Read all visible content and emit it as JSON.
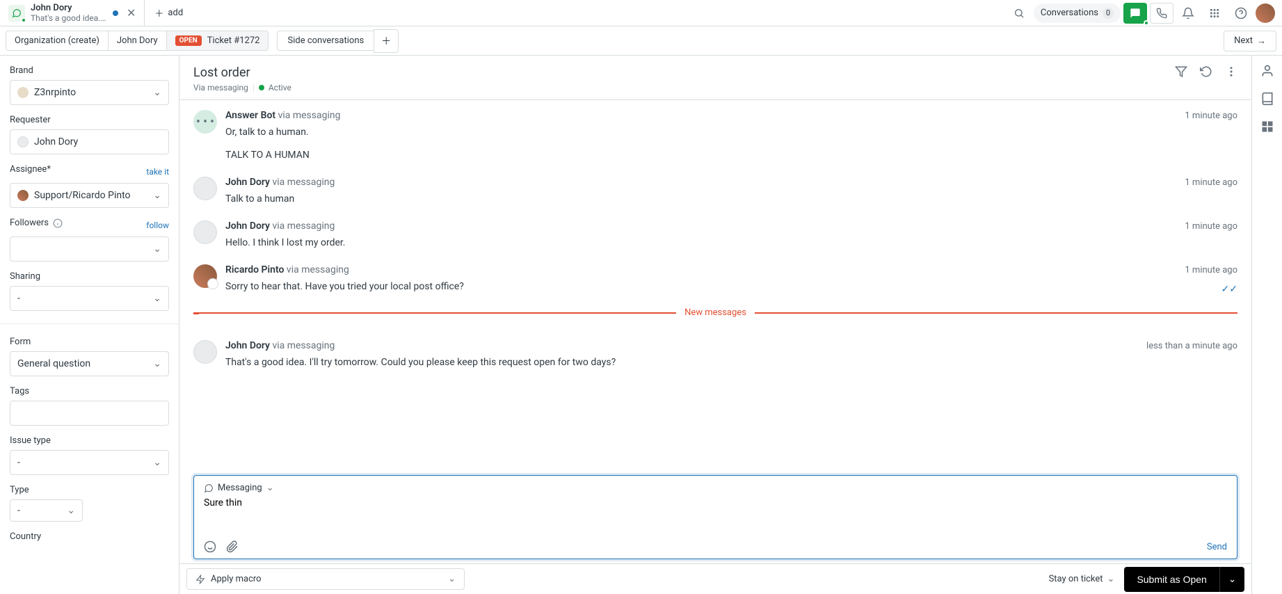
{
  "top": {
    "tab": {
      "title": "John Dory",
      "subtitle": "That's a good idea. I…"
    },
    "add_label": "add",
    "conversations_label": "Conversations",
    "conversations_count": "0"
  },
  "crumbs": {
    "org": "Organization (create)",
    "user": "John Dory",
    "badge": "OPEN",
    "ticket": "Ticket #1272",
    "side_conv": "Side conversations",
    "next": "Next"
  },
  "sidebar": {
    "brand_label": "Brand",
    "brand_value": "Z3nrpinto",
    "requester_label": "Requester",
    "requester_value": "John Dory",
    "assignee_label": "Assignee*",
    "take_it": "take it",
    "assignee_value": "Support/Ricardo Pinto",
    "followers_label": "Followers",
    "follow": "follow",
    "sharing_label": "Sharing",
    "sharing_value": "-",
    "form_label": "Form",
    "form_value": "General question",
    "tags_label": "Tags",
    "issue_label": "Issue type",
    "issue_value": "-",
    "type_label": "Type",
    "type_value": "-",
    "country_label": "Country"
  },
  "header": {
    "title": "Lost order",
    "via": "Via messaging",
    "active": "Active"
  },
  "messages": [
    {
      "author": "Answer Bot",
      "via": "via messaging",
      "time": "1 minute ago",
      "text": "Or, talk to a human.",
      "upper": "TALK TO A HUMAN",
      "avatar": "bot"
    },
    {
      "author": "John Dory",
      "via": "via messaging",
      "time": "1 minute ago",
      "text": "Talk to a human",
      "avatar": "user"
    },
    {
      "author": "John Dory",
      "via": "via messaging",
      "time": "1 minute ago",
      "text": "Hello. I think I lost my order.",
      "avatar": "user"
    },
    {
      "author": "Ricardo Pinto",
      "via": "via messaging",
      "time": "1 minute ago",
      "text": "Sorry to hear that. Have you tried your local post office?",
      "avatar": "agent",
      "read": true
    }
  ],
  "new_messages": "New messages",
  "messages_after": [
    {
      "author": "John Dory",
      "via": "via messaging",
      "time": "less than a minute ago",
      "text": "That's a good idea. I'll try tomorrow. Could you please keep this request open for two days?",
      "avatar": "user"
    }
  ],
  "composer": {
    "channel": "Messaging",
    "value": "Sure thin",
    "send": "Send"
  },
  "footer": {
    "macro": "Apply macro",
    "stay": "Stay on ticket",
    "submit": "Submit as Open"
  }
}
